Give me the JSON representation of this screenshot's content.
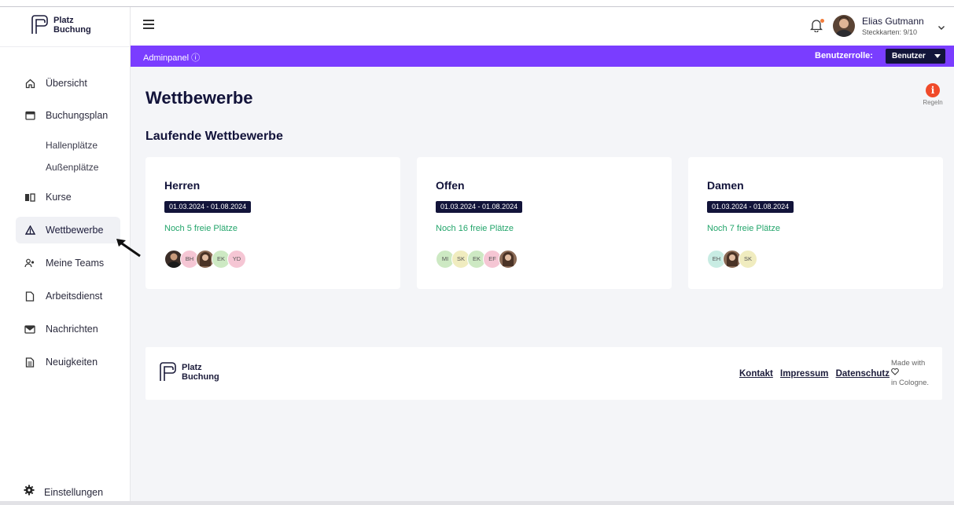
{
  "app": {
    "logo_line1": "Platz",
    "logo_line2": "Buchung"
  },
  "sidebar": {
    "items": [
      {
        "label": "Übersicht"
      },
      {
        "label": "Buchungsplan"
      },
      {
        "label": "Kurse"
      },
      {
        "label": "Wettbewerbe"
      },
      {
        "label": "Meine Teams"
      },
      {
        "label": "Arbeitsdienst"
      },
      {
        "label": "Nachrichten"
      },
      {
        "label": "Neuigkeiten"
      }
    ],
    "subitems": [
      {
        "label": "Hallenplätze"
      },
      {
        "label": "Außenplätze"
      }
    ],
    "settings_label": "Einstellungen",
    "active": "Wettbewerbe"
  },
  "header": {
    "user_name": "Elias Gutmann",
    "user_sub": "Steckkarten: 9/10"
  },
  "adminbar": {
    "label": "Adminpanel ⓘ",
    "role_label": "Benutzerrolle:",
    "role_value": "Benutzer"
  },
  "main": {
    "title": "Wettbewerbe",
    "rules_label": "Regeln",
    "section_title": "Laufende Wettbewerbe",
    "cards": [
      {
        "title": "Herren",
        "date": "01.03.2024 - 01.08.2024",
        "free": "Noch 5 freie Plätze",
        "avatars": [
          "",
          "BH",
          "",
          "EK",
          "YD"
        ]
      },
      {
        "title": "Offen",
        "date": "01.03.2024 - 01.08.2024",
        "free": "Noch 16 freie Plätze",
        "avatars": [
          "MI",
          "SK",
          "EK",
          "EF",
          ""
        ]
      },
      {
        "title": "Damen",
        "date": "01.03.2024 - 01.08.2024",
        "free": "Noch 7 freie Plätze",
        "avatars": [
          "EH",
          "",
          "SK"
        ]
      }
    ]
  },
  "footer": {
    "logo_line1": "Platz",
    "logo_line2": "Buchung",
    "links": [
      "Kontakt",
      "Impressum",
      "Datenschutz"
    ],
    "made_line1": "Made with",
    "made_line2": "in Cologne."
  },
  "colors": {
    "accent": "#7a3dff",
    "navy": "#12143a",
    "green": "#23a56b",
    "danger": "#f04a2a"
  }
}
